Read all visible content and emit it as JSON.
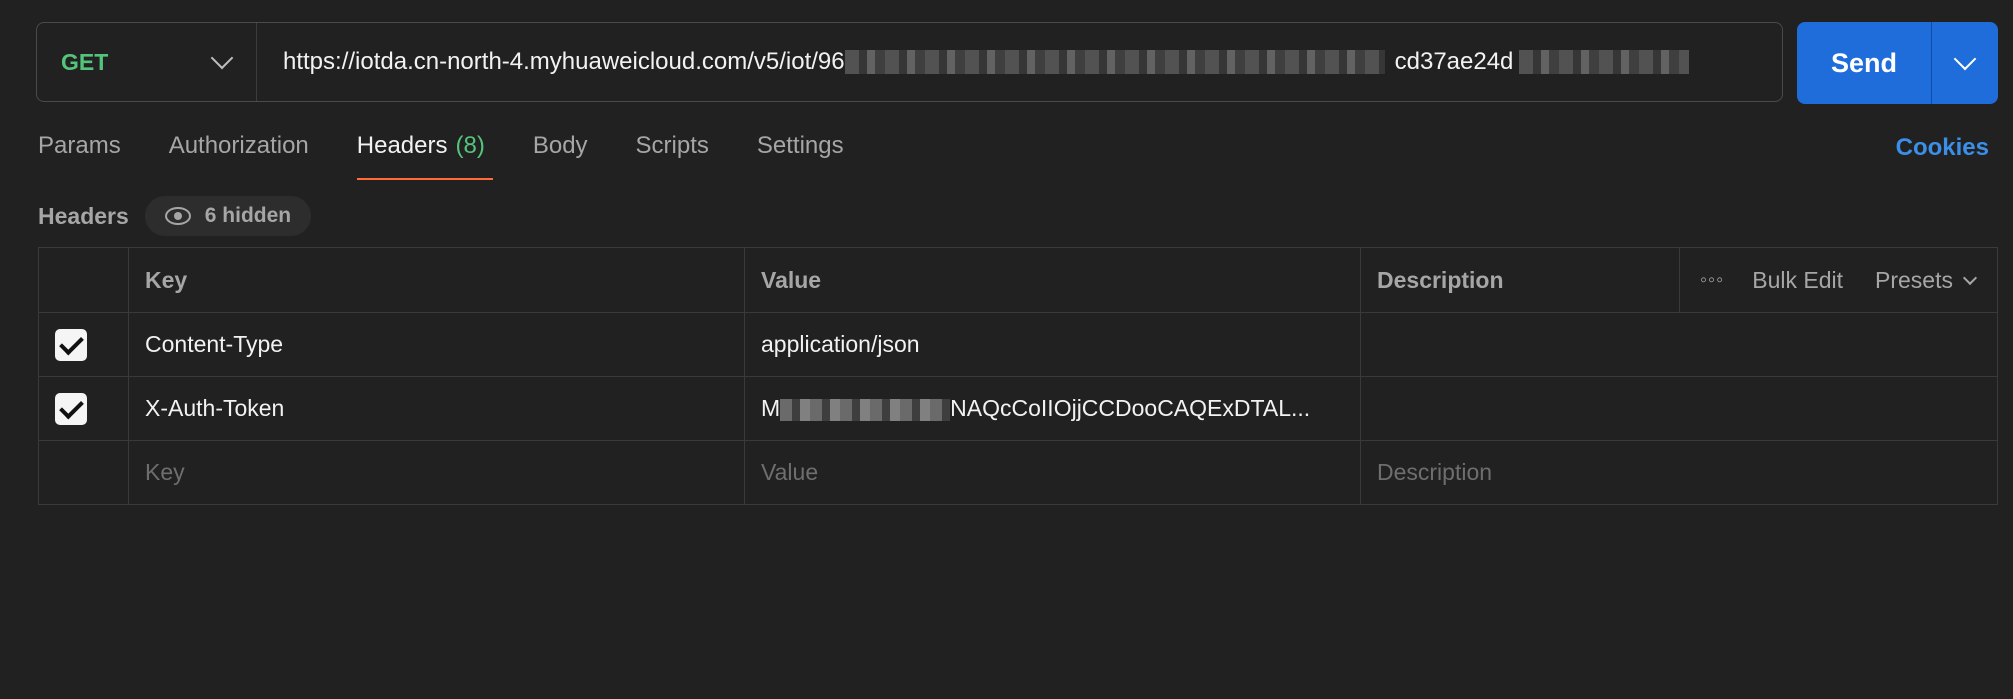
{
  "request": {
    "method": "GET",
    "url_visible_start": "https://iotda.cn-north-4.myhuaweicloud.com/v5/iot/96",
    "url_visible_end": "cd37ae24d",
    "send_label": "Send"
  },
  "tabs": [
    {
      "label": "Params"
    },
    {
      "label": "Authorization"
    },
    {
      "label": "Headers",
      "count": "(8)"
    },
    {
      "label": "Body"
    },
    {
      "label": "Scripts"
    },
    {
      "label": "Settings"
    }
  ],
  "cookies_label": "Cookies",
  "headers_section": {
    "title": "Headers",
    "hidden_label": "6 hidden"
  },
  "table": {
    "columns": {
      "key": "Key",
      "value": "Value",
      "description": "Description"
    },
    "actions": {
      "bulk_edit": "Bulk Edit",
      "presets": "Presets"
    },
    "rows": [
      {
        "checked": true,
        "key": "Content-Type",
        "value": "application/json",
        "description": ""
      },
      {
        "checked": true,
        "key": "X-Auth-Token",
        "value_start": "M",
        "value_end": "NAQcCoIIOjjCCDooCAQExDTAL...",
        "description": ""
      }
    ],
    "placeholders": {
      "key": "Key",
      "value": "Value",
      "description": "Description"
    }
  },
  "colors": {
    "method": "#54c47a",
    "send": "#1f6dda",
    "active_tab_underline": "#ff6c37",
    "cookies": "#3b8fe8"
  }
}
